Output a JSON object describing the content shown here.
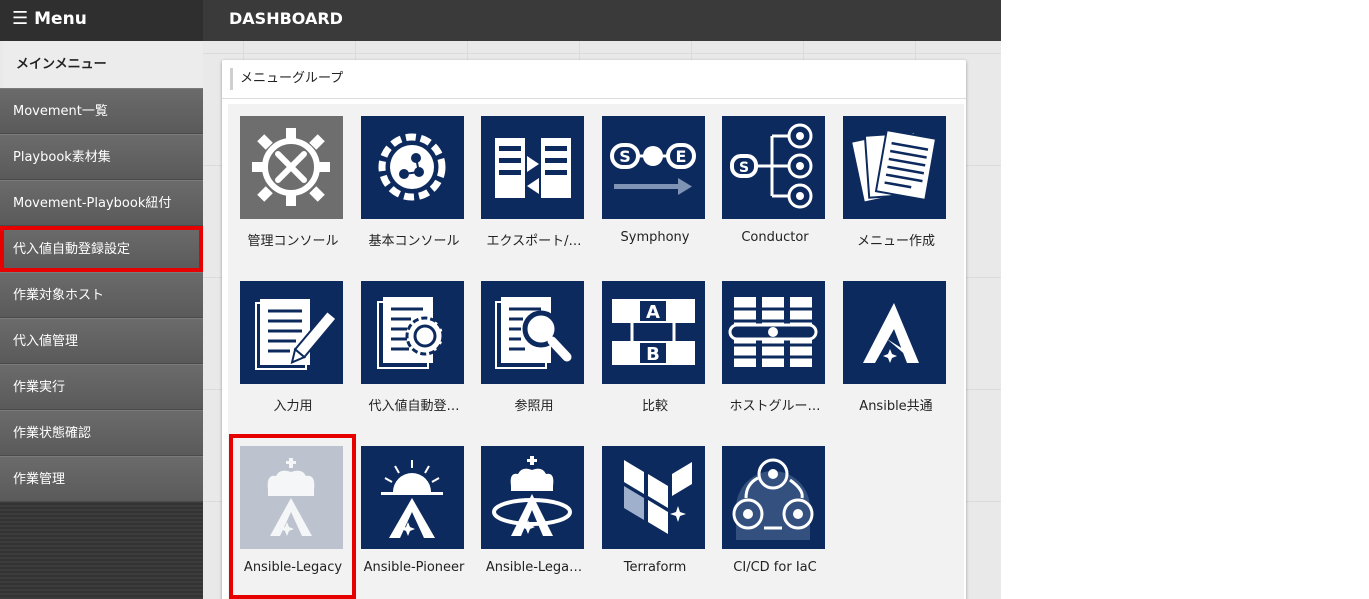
{
  "header": {
    "menu_label": "Menu",
    "menu_icon": "hamburger-icon",
    "page_title": "DASHBOARD"
  },
  "sidebar": {
    "heading": "メインメニュー",
    "items": [
      {
        "label": "Movement一覧"
      },
      {
        "label": "Playbook素材集"
      },
      {
        "label": "Movement-Playbook紐付"
      },
      {
        "label": "代入値自動登録設定",
        "highlighted": true
      },
      {
        "label": "作業対象ホスト"
      },
      {
        "label": "代入値管理"
      },
      {
        "label": "作業実行"
      },
      {
        "label": "作業状態確認"
      },
      {
        "label": "作業管理"
      }
    ]
  },
  "panel": {
    "title": "メニューグループ",
    "tiles": [
      {
        "label": "管理コンソール",
        "icon": "gear-tools-icon"
      },
      {
        "label": "基本コンソール",
        "icon": "gear-network-icon"
      },
      {
        "label": "エクスポート/…",
        "icon": "export-import-icon"
      },
      {
        "label": "Symphony",
        "icon": "symphony-icon"
      },
      {
        "label": "Conductor",
        "icon": "conductor-icon"
      },
      {
        "label": "メニュー作成",
        "icon": "menu-create-icon"
      },
      {
        "label": "入力用",
        "icon": "input-document-icon"
      },
      {
        "label": "代入値自動登…",
        "icon": "document-gear-icon"
      },
      {
        "label": "参照用",
        "icon": "document-search-icon"
      },
      {
        "label": "比較",
        "icon": "compare-icon"
      },
      {
        "label": "ホストグルー…",
        "icon": "host-group-icon"
      },
      {
        "label": "Ansible共通",
        "icon": "ansible-icon"
      },
      {
        "label": "Ansible-Legacy",
        "icon": "ansible-legacy-icon",
        "highlighted": true
      },
      {
        "label": "Ansible-Pioneer",
        "icon": "ansible-pioneer-icon"
      },
      {
        "label": "Ansible-Lega…",
        "icon": "ansible-legacy-role-icon"
      },
      {
        "label": "Terraform",
        "icon": "terraform-icon"
      },
      {
        "label": "CI/CD for IaC",
        "icon": "cicd-icon"
      }
    ]
  },
  "colors": {
    "tile_blue": "#0d2a5e",
    "tile_gray": "#6e6e6e",
    "highlight_red": "#e60000",
    "sidebar_item": "#5f5f5f"
  }
}
